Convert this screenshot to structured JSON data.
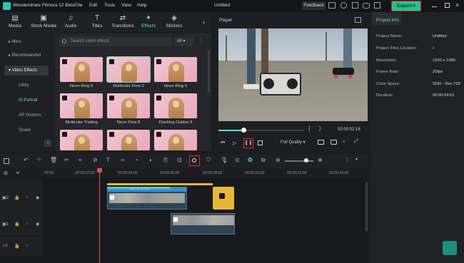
{
  "app": {
    "title": "Wondershare Filmora 12 Beta",
    "menu": [
      "File",
      "Edit",
      "Tools",
      "View",
      "Help"
    ],
    "project_name": "Untitled",
    "feedback_label": "Feedback",
    "export_label": "Export"
  },
  "toolbar": {
    "tabs": [
      {
        "label": "Media",
        "icon": "media-icon"
      },
      {
        "label": "Stock Media",
        "icon": "stock-media-icon"
      },
      {
        "label": "Audio",
        "icon": "music-icon"
      },
      {
        "label": "Titles",
        "icon": "titles-icon"
      },
      {
        "label": "Transitions",
        "icon": "transitions-icon"
      },
      {
        "label": "Effects",
        "icon": "effects-icon"
      },
      {
        "label": "Stickers",
        "icon": "stickers-icon"
      }
    ],
    "active": "Effects"
  },
  "sidebar": {
    "items": [
      {
        "label": "Mine"
      },
      {
        "label": "Recommended"
      },
      {
        "label": "Video Effects"
      },
      {
        "label": "Utility"
      },
      {
        "label": "AI Portrait"
      },
      {
        "label": "AR Stickers"
      },
      {
        "label": "Shake"
      }
    ],
    "selected": "Video Effects",
    "active_sub": "AI Portrait"
  },
  "effects": {
    "search_placeholder": "Search video effects",
    "filter_label": "All",
    "items": [
      {
        "label": "Neon Ring 9"
      },
      {
        "label": "Multicolor Flow 2"
      },
      {
        "label": "Neon Ring 5"
      },
      {
        "label": "Multicolor Trailing"
      },
      {
        "label": "Neon Flow 8"
      },
      {
        "label": "Flashing Outline 9"
      },
      {
        "label": ""
      },
      {
        "label": ""
      },
      {
        "label": ""
      }
    ]
  },
  "player": {
    "label": "Player",
    "timecode": "00:00:02:16",
    "quality": "Full Quality"
  },
  "project_info": {
    "title": "Project Info",
    "rows": [
      {
        "label": "Project Name:",
        "value": "Untitled"
      },
      {
        "label": "Project Files Location:",
        "value": "/"
      },
      {
        "label": "Resolution:",
        "value": "1920 x 1080"
      },
      {
        "label": "Frame Rate:",
        "value": "25fps"
      },
      {
        "label": "Color Space:",
        "value": "SDR - Rec.709"
      },
      {
        "label": "Duration:",
        "value": "00:00:09:01"
      }
    ]
  },
  "timeline": {
    "ruler": [
      "00:00",
      "00:00:02:00",
      "00:00:04:00",
      "00:00:06:00",
      "00:00:08:00",
      "00:00:10:00",
      "00:00:12:00",
      "00:00:14:00"
    ],
    "clip_label": "Normal 1.00x",
    "colors": {
      "accent": "#22c38e",
      "highlight": "#e0252d",
      "playhead": "#e0505a",
      "effect_clip": "#e8b73a"
    }
  }
}
